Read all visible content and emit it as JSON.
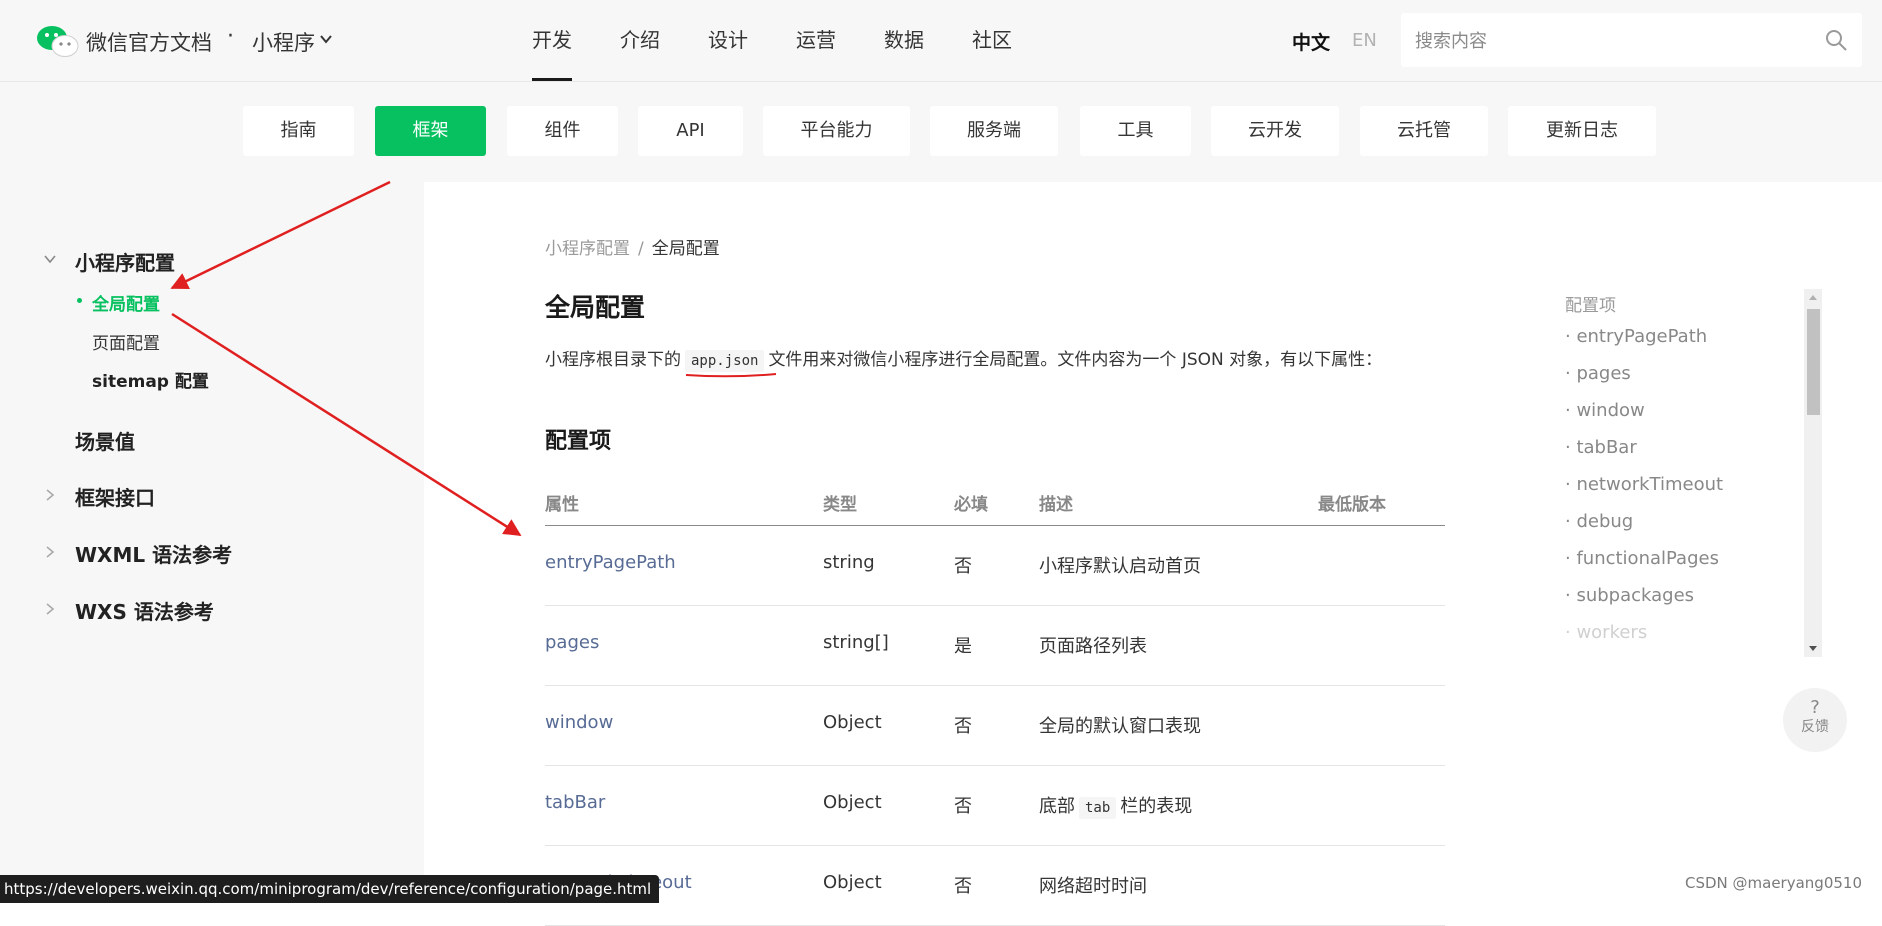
{
  "header": {
    "brand": "微信官方文档",
    "brand_dot": "·",
    "section": "小程序",
    "nav": [
      "开发",
      "介绍",
      "设计",
      "运营",
      "数据",
      "社区"
    ],
    "lang_zh": "中文",
    "lang_en": "EN",
    "search_placeholder": "搜索内容"
  },
  "subnav": [
    "指南",
    "框架",
    "组件",
    "API",
    "平台能力",
    "服务端",
    "工具",
    "云开发",
    "云托管",
    "更新日志"
  ],
  "sidebar": {
    "group1": "小程序配置",
    "group1_items": [
      "全局配置",
      "页面配置",
      "sitemap 配置"
    ],
    "scenes": "场景值",
    "framework_api": "框架接口",
    "wxml": "WXML 语法参考",
    "wxs": "WXS 语法参考"
  },
  "content": {
    "breadcrumb_parent": "小程序配置",
    "breadcrumb_sep": "/",
    "breadcrumb_current": "全局配置",
    "title": "全局配置",
    "intro_before": "小程序根目录下的",
    "intro_code": "app.json",
    "intro_after": "文件用来对微信小程序进行全局配置。文件内容为一个 JSON 对象，有以下属性：",
    "section_title": "配置项",
    "table": {
      "headers": [
        "属性",
        "类型",
        "必填",
        "描述",
        "最低版本"
      ],
      "rows": [
        {
          "attr": "entryPagePath",
          "type": "string",
          "required": "否",
          "desc": "小程序默认启动首页"
        },
        {
          "attr": "pages",
          "type": "string[]",
          "required": "是",
          "desc": "页面路径列表"
        },
        {
          "attr": "window",
          "type": "Object",
          "required": "否",
          "desc": "全局的默认窗口表现"
        },
        {
          "attr": "tabBar",
          "type": "Object",
          "required": "否",
          "desc_before": "底部",
          "desc_code": "tab",
          "desc_after": "栏的表现"
        },
        {
          "attr": "networkTimeout",
          "type": "Object",
          "required": "否",
          "desc": "网络超时时间"
        }
      ]
    }
  },
  "toc": {
    "title": "配置项",
    "items": [
      "· entryPagePath",
      "· pages",
      "· window",
      "· tabBar",
      "· networkTimeout",
      "· debug",
      "· functionalPages",
      "· subpackages",
      "· workers"
    ]
  },
  "feedback": {
    "icon": "?",
    "label": "反馈"
  },
  "status_url": "https://developers.weixin.qq.com/miniprogram/dev/reference/configuration/page.html",
  "watermark": "CSDN @maeryang0510",
  "colors": {
    "brand_green": "#07c160",
    "link": "#576b95",
    "annotation_red": "#e02020"
  }
}
